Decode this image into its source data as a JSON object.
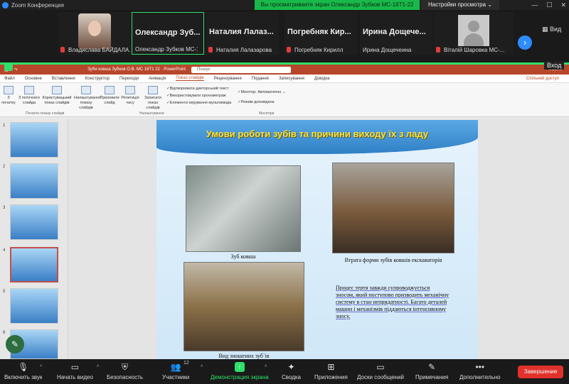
{
  "app_title": "Zoom Конференция",
  "share_banner": "Вы просматриваете экран Олександр Зубков МС-16Т1-22",
  "view_options": "Настройки просмотра",
  "gallery": {
    "tiles": [
      {
        "name": "Владислава БАЙДАЛА..."
      },
      {
        "big": "Олександр Зуб...",
        "name": "Олександр Зубков МС-1..."
      },
      {
        "big": "Наталия Лалаз...",
        "name": "Наталия Лалазарова"
      },
      {
        "big": "Погребняк Кир...",
        "name": "Погребняк Кирилл"
      },
      {
        "big": "Ирина Дощече...",
        "name": "Ирина Дощечеина"
      },
      {
        "name": "Віталій Шаровка МС-..."
      }
    ],
    "view_label": "Вид",
    "exit_label": "Вход"
  },
  "ppt": {
    "title": "Зуби ковша Зубков О.В. МС 16Т1 22 · PowerPoint",
    "search": "Пошук",
    "right": "Увійти",
    "tabs": [
      "Файл",
      "Основне",
      "Вставлення",
      "Конструктор",
      "Переходи",
      "Анімація",
      "Показ слайдів",
      "Рецензування",
      "Подання",
      "Записування",
      "Довідка"
    ],
    "selected_tab": "Показ слайдів",
    "share_label": "Спільний доступ",
    "ribbon": {
      "b1": "З початку",
      "b2": "З поточного слайда",
      "b3": "Користувацький показ слайдів",
      "b4": "Налаштування показу слайдів",
      "b5": "Приховати слайд",
      "b6": "Репетиція часу",
      "b7": "Записати показ слайдів",
      "c1": "Відтворювати дикторський текст",
      "c2": "Використовувати хронометраж",
      "c3": "Елементи керування мультимедіа",
      "monitor": "Монітор:",
      "monitor_value": "Автоматично",
      "presenter": "Режим доповідача",
      "g1": "Початок показу слайдів",
      "g2": "Налаштування",
      "g3": "Монітори"
    },
    "thumb_numbers": [
      "1",
      "2",
      "3",
      "4",
      "5",
      "6"
    ]
  },
  "slide": {
    "title": "Умови роботи зубів та причини виходу їх з ладу",
    "cap1": "Зуб ковша",
    "cap2": "Втрата форми зубів ковшів екскаваторів",
    "cap3": "Вид зношених зуб`ів",
    "paragraph": "Процес тертя завжди супроводжується зносом, який поступово призводить механічну систему в стан непридатності. Багато деталей машин і механізмів піддаються інтенсивному зносу."
  },
  "toolbar": {
    "mute": "Включить звук",
    "video": "Начать видео",
    "security": "Безопасность",
    "participants": "Участники",
    "participants_count": "12",
    "share": "Демонстрация экрана",
    "summary": "Сводка",
    "apps": "Приложения",
    "boards": "Доски сообщений",
    "notes": "Примечания",
    "more": "Дополнительно",
    "end": "Завершение"
  },
  "colors": {
    "banner": "#19b84b",
    "end": "#e0312a",
    "ppt_accent": "#b7472a",
    "zoom_blue": "#2d8cff"
  }
}
